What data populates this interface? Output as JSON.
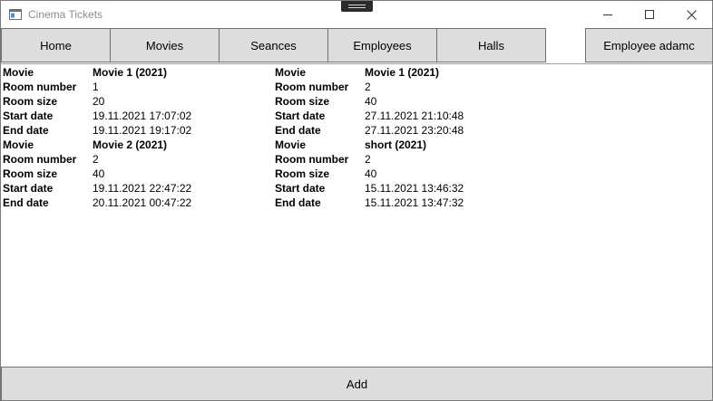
{
  "window": {
    "title": "Cinema Tickets"
  },
  "nav": {
    "home": "Home",
    "movies": "Movies",
    "seances": "Seances",
    "employees": "Employees",
    "halls": "Halls",
    "user": "Employee adamc"
  },
  "labels": {
    "movie": "Movie",
    "room_number": "Room number",
    "room_size": "Room size",
    "start_date": "Start date",
    "end_date": "End date"
  },
  "seances": [
    {
      "movie": "Movie 1 (2021)",
      "room_number": "1",
      "room_size": "20",
      "start_date": "19.11.2021 17:07:02",
      "end_date": "19.11.2021 19:17:02"
    },
    {
      "movie": "Movie 1 (2021)",
      "room_number": "2",
      "room_size": "40",
      "start_date": "27.11.2021 21:10:48",
      "end_date": "27.11.2021 23:20:48"
    },
    {
      "movie": "Movie 2 (2021)",
      "room_number": "2",
      "room_size": "40",
      "start_date": "19.11.2021 22:47:22",
      "end_date": "20.11.2021 00:47:22"
    },
    {
      "movie": "short (2021)",
      "room_number": "2",
      "room_size": "40",
      "start_date": "15.11.2021 13:46:32",
      "end_date": "15.11.2021 13:47:32"
    }
  ],
  "actions": {
    "add": "Add"
  }
}
